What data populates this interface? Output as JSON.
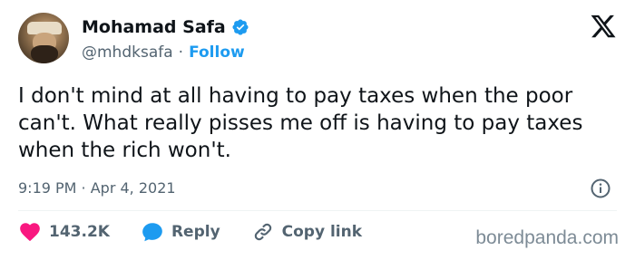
{
  "user": {
    "display_name": "Mohamad Safa",
    "handle": "@mhdksafa",
    "separator": "·",
    "follow_label": "Follow"
  },
  "tweet": {
    "text": "I don't mind at all having to pay taxes when the poor can't. What really pisses me off is having to pay taxes when the rich won't.",
    "timestamp": "9:19 PM · Apr 4, 2021"
  },
  "actions": {
    "like_count": "143.2K",
    "reply_label": "Reply",
    "copy_link_label": "Copy link"
  },
  "watermark": "boredpanda.com",
  "colors": {
    "like": "#f91880",
    "reply": "#1d9bf0",
    "verified": "#1d9bf0",
    "follow": "#1d9bf0",
    "secondary_text": "#536471"
  },
  "icons": {
    "verified": "verified-badge-icon",
    "logo": "x-logo-icon",
    "info": "info-icon",
    "like": "heart-icon",
    "reply": "speech-bubble-icon",
    "copy_link": "link-icon"
  }
}
